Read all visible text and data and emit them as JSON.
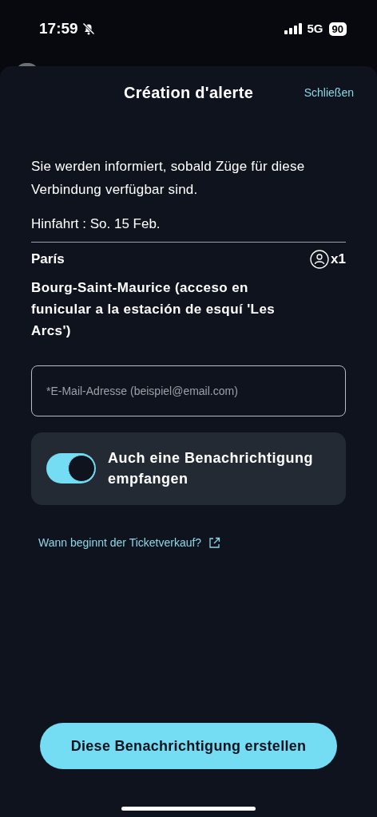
{
  "status_bar": {
    "time": "17:59",
    "silent": true,
    "network": "5G",
    "battery": "90"
  },
  "sheet": {
    "title": "Création d'alerte",
    "close": "Schließen"
  },
  "info": "Sie werden informiert, sobald Züge für diese Verbindung verfügbar sind.",
  "outbound": "Hinfahrt : So. 15 Feb.",
  "journey": {
    "origin": "París",
    "passengers": "x1",
    "destination": "Bourg-Saint-Maurice (acceso en funicular a la estación de esquí 'Les Arcs')"
  },
  "email_field": {
    "placeholder": "*E-Mail-Adresse (beispiel@email.com)"
  },
  "notification_toggle": {
    "label": "Auch eine Benachrichtigung empfangen",
    "on": true
  },
  "link": "Wann beginnt der Ticketverkauf?",
  "submit": "Diese Benachrichtigung erstellen"
}
